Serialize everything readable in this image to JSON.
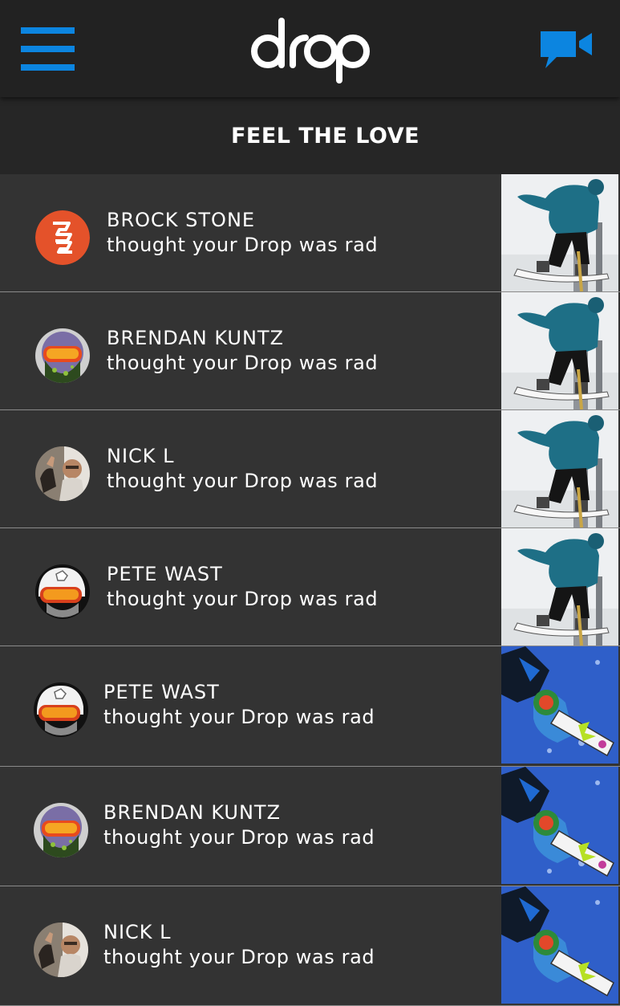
{
  "app": {
    "logo_text": "drop",
    "section_title": "FEEL THE LOVE"
  },
  "colors": {
    "accent": "#0c85e0",
    "topbar": "#222222",
    "row_bg": "#333333",
    "divider": "#8a8a8a"
  },
  "icons": {
    "menu": "hamburger-menu-icon",
    "video": "video-camera-icon"
  },
  "notifications": [
    {
      "name": "BROCK STONE",
      "action": "thought your Drop was rad",
      "avatar": "brand-logo",
      "thumb": "rail-rider"
    },
    {
      "name": "BRENDAN KUNTZ",
      "action": "thought your Drop was rad",
      "avatar": "goggles-mask",
      "thumb": "rail-rider"
    },
    {
      "name": "NICK L",
      "action": "thought your Drop was rad",
      "avatar": "selfie",
      "thumb": "rail-rider"
    },
    {
      "name": "PETE WAST",
      "action": "thought your Drop was rad",
      "avatar": "helmet",
      "thumb": "rail-rider"
    },
    {
      "name": "PETE WAST",
      "action": "thought your Drop was rad",
      "avatar": "helmet",
      "thumb": "air-grab"
    },
    {
      "name": "BRENDAN KUNTZ",
      "action": "thought your Drop was rad",
      "avatar": "goggles-mask",
      "thumb": "air-grab"
    },
    {
      "name": "NICK L",
      "action": "thought your Drop was rad",
      "avatar": "selfie",
      "thumb": "air-grab"
    }
  ]
}
